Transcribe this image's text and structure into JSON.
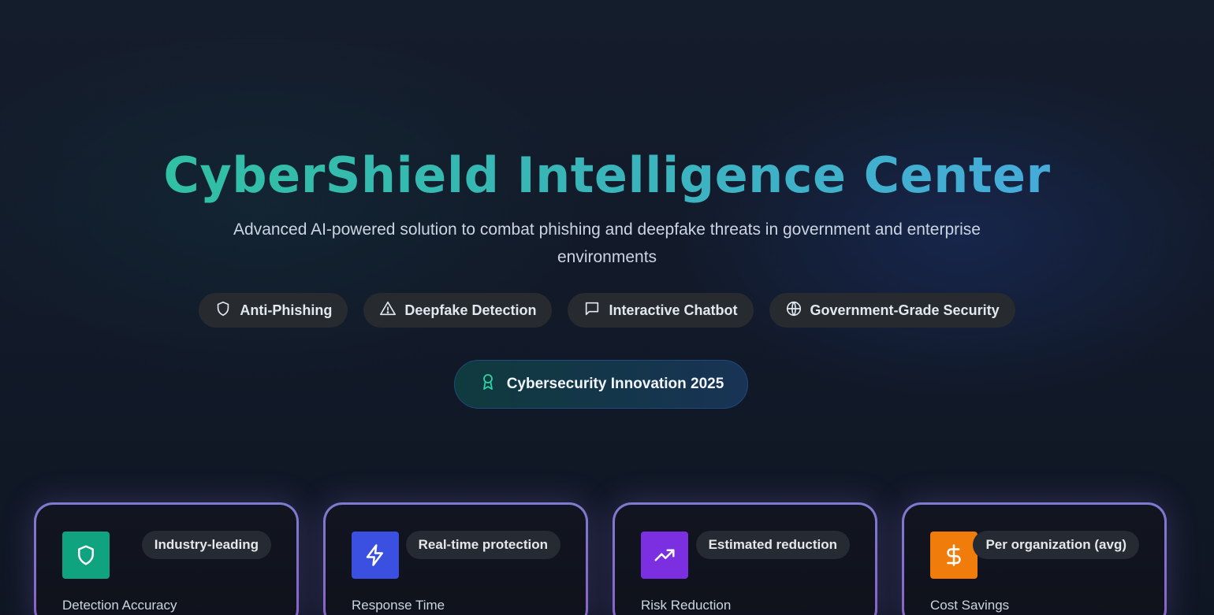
{
  "hero": {
    "title": "CyberShield Intelligence Center",
    "subtitle": "Advanced AI-powered solution to combat phishing and deepfake threats in government and enterprise environments",
    "title_gradient": [
      "#2dc49c",
      "#4aa8e6"
    ]
  },
  "tags": [
    {
      "label": "Anti-Phishing",
      "icon": "shield-icon"
    },
    {
      "label": "Deepfake Detection",
      "icon": "warning-triangle-icon"
    },
    {
      "label": "Interactive Chatbot",
      "icon": "chat-bubble-icon"
    },
    {
      "label": "Government-Grade Security",
      "icon": "globe-icon"
    }
  ],
  "award": {
    "label": "Cybersecurity Innovation 2025",
    "icon": "award-ribbon-icon",
    "icon_color": "#2dd4a4"
  },
  "cards": [
    {
      "badge": "Industry-leading",
      "label": "Detection Accuracy",
      "icon": "shield-icon",
      "color": "#10a37f"
    },
    {
      "badge": "Real-time protection",
      "label": "Response Time",
      "icon": "lightning-icon",
      "color": "#3b4fe0"
    },
    {
      "badge": "Estimated reduction",
      "label": "Risk Reduction",
      "icon": "trending-up-icon",
      "color": "#7c2fe0"
    },
    {
      "badge": "Per organization (avg)",
      "label": "Cost Savings",
      "icon": "dollar-icon",
      "color": "#f07c0c"
    }
  ]
}
